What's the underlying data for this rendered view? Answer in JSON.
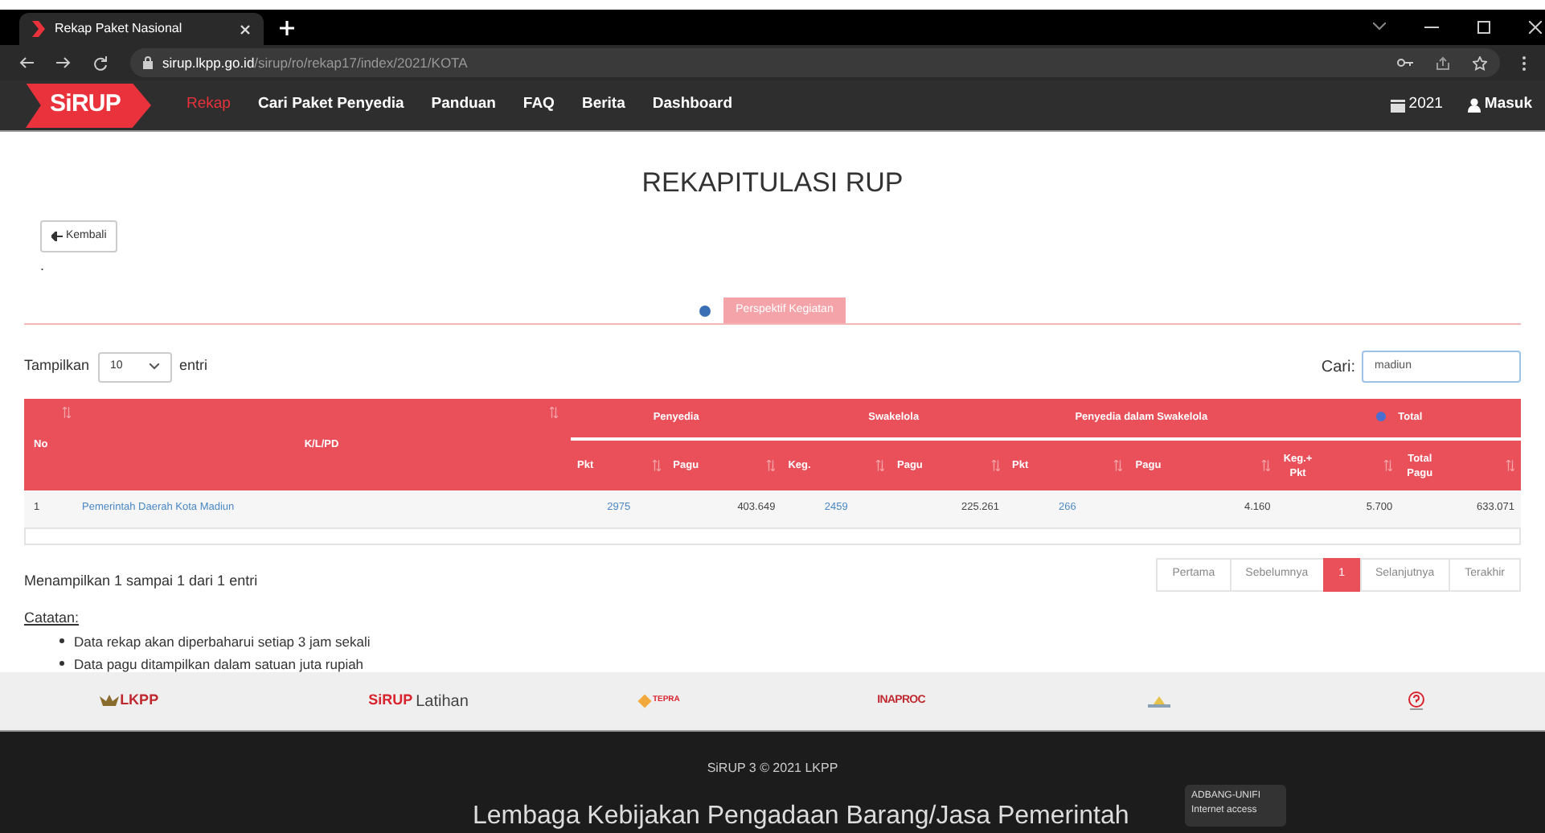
{
  "browser": {
    "tab_title": "Rekap Paket Nasional",
    "url_host": "sirup.lkpp.go.id",
    "url_path": "/sirup/ro/rekap17/index/2021/KOTA"
  },
  "navbar": {
    "logo": "SiRUP",
    "items": [
      {
        "label": "Rekap",
        "selected": true
      },
      {
        "label": "Cari Paket Penyedia",
        "selected": false
      },
      {
        "label": "Panduan",
        "selected": false
      },
      {
        "label": "FAQ",
        "selected": false
      },
      {
        "label": "Berita",
        "selected": false
      },
      {
        "label": "Dashboard",
        "selected": false
      }
    ],
    "year": "2021",
    "login": "Masuk"
  },
  "page": {
    "title": "REKAPITULASI RUP",
    "back_button": "Kembali",
    "dot": ".",
    "tabs": [
      {
        "label": "Perspektif Kegiatan",
        "selected": true
      }
    ]
  },
  "table": {
    "length_label": "Tampilkan",
    "length_value": "10",
    "length_suffix": "entri",
    "search_label": "Cari:",
    "search_value": "madiun",
    "columns": [
      {
        "label": "No"
      },
      {
        "label": "K/L/PD"
      }
    ],
    "groups": [
      {
        "label": "Penyedia",
        "columns": [
          "Pkt",
          "Pagu"
        ]
      },
      {
        "label": "Swakelola",
        "columns": [
          "Keg.",
          "Pagu"
        ]
      },
      {
        "label": "Penyedia dalam Swakelola",
        "columns": [
          "Pkt",
          "Pagu"
        ]
      },
      {
        "label": "Total",
        "columns": [
          "Keg.+ Pkt",
          "Total Pagu"
        ]
      }
    ],
    "rows": [
      [
        {
          "kind": "text",
          "text": "1"
        },
        {
          "kind": "link",
          "text": "Pemerintah Daerah Kota Madiun"
        },
        {
          "kind": "link",
          "text": "2975"
        },
        {
          "kind": "text",
          "text": "403.649"
        },
        {
          "kind": "link",
          "text": "2459"
        },
        {
          "kind": "text",
          "text": "225.261"
        },
        {
          "kind": "link",
          "text": "266"
        },
        {
          "kind": "text",
          "text": "4.160"
        },
        {
          "kind": "text",
          "text": "5.700"
        },
        {
          "kind": "text",
          "text": "633.071"
        }
      ]
    ],
    "info": "Menampilkan 1 sampai 1 dari 1 entri",
    "pagination": [
      {
        "label": "Pertama",
        "selected": false
      },
      {
        "label": "Sebelumnya",
        "selected": false
      },
      {
        "label": "1",
        "selected": true
      },
      {
        "label": "Selanjutnya",
        "selected": false
      },
      {
        "label": "Terakhir",
        "selected": false
      }
    ]
  },
  "notes": {
    "title": "Catatan:",
    "items": [
      "Data rekap akan diperbaharui setiap 3 jam sekali",
      "Data pagu ditampilkan dalam satuan juta rupiah"
    ]
  },
  "partners": [
    {
      "kind": "lkpp",
      "text": "LKPP"
    },
    {
      "kind": "sirup",
      "text": "SiRUP",
      "label": "Latihan"
    },
    {
      "kind": "tepra",
      "text": "TEPRA"
    },
    {
      "kind": "inaproc",
      "text": "INAPROC"
    },
    {
      "kind": "emblem"
    },
    {
      "kind": "helpdesk"
    }
  ],
  "footer": {
    "copyright": "SiRUP 3 © 2021 LKPP",
    "org": "Lembaga Kebijakan Pengadaan Barang/Jasa Pemerintah",
    "tooltip": [
      "ADBANG-UNIFI",
      "Internet access"
    ]
  }
}
